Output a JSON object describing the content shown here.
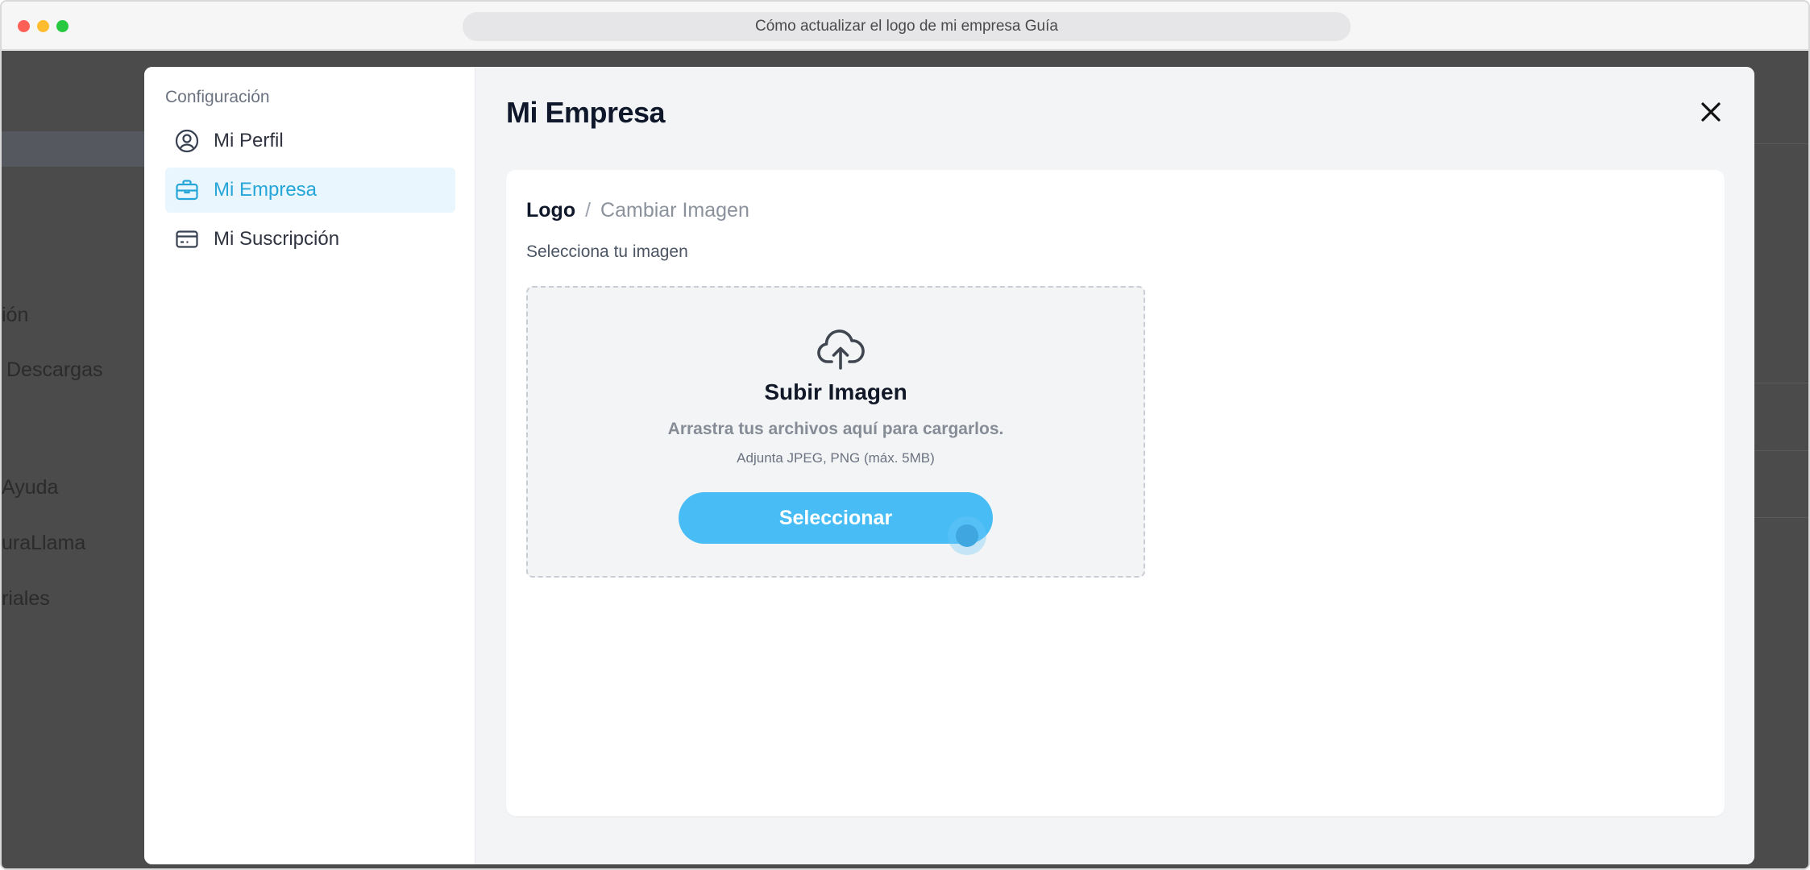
{
  "window": {
    "url_title": "Cómo actualizar el logo de mi empresa Guía"
  },
  "background": {
    "items": [
      "ión",
      "Descargas",
      "Ayuda",
      "uraLlama",
      "riales"
    ]
  },
  "sidebar": {
    "heading": "Configuración",
    "items": [
      {
        "label": "Mi Perfil",
        "icon": "user-circle-icon",
        "active": false
      },
      {
        "label": "Mi Empresa",
        "icon": "briefcase-icon",
        "active": true
      },
      {
        "label": "Mi Suscripción",
        "icon": "credit-card-icon",
        "active": false
      }
    ]
  },
  "main": {
    "title": "Mi Empresa",
    "breadcrumb": {
      "root": "Logo",
      "separator": "/",
      "current": "Cambiar Imagen"
    },
    "select_label": "Selecciona tu imagen",
    "dropzone": {
      "title": "Subir Imagen",
      "subtitle": "Arrastra tus archivos aquí para cargarlos.",
      "hint": "Adjunta JPEG, PNG (máx. 5MB)",
      "button_label": "Seleccionar"
    }
  },
  "colors": {
    "accent": "#48bcf5",
    "active_nav_bg": "#e9f6fd",
    "active_nav_text": "#26a6d8"
  }
}
